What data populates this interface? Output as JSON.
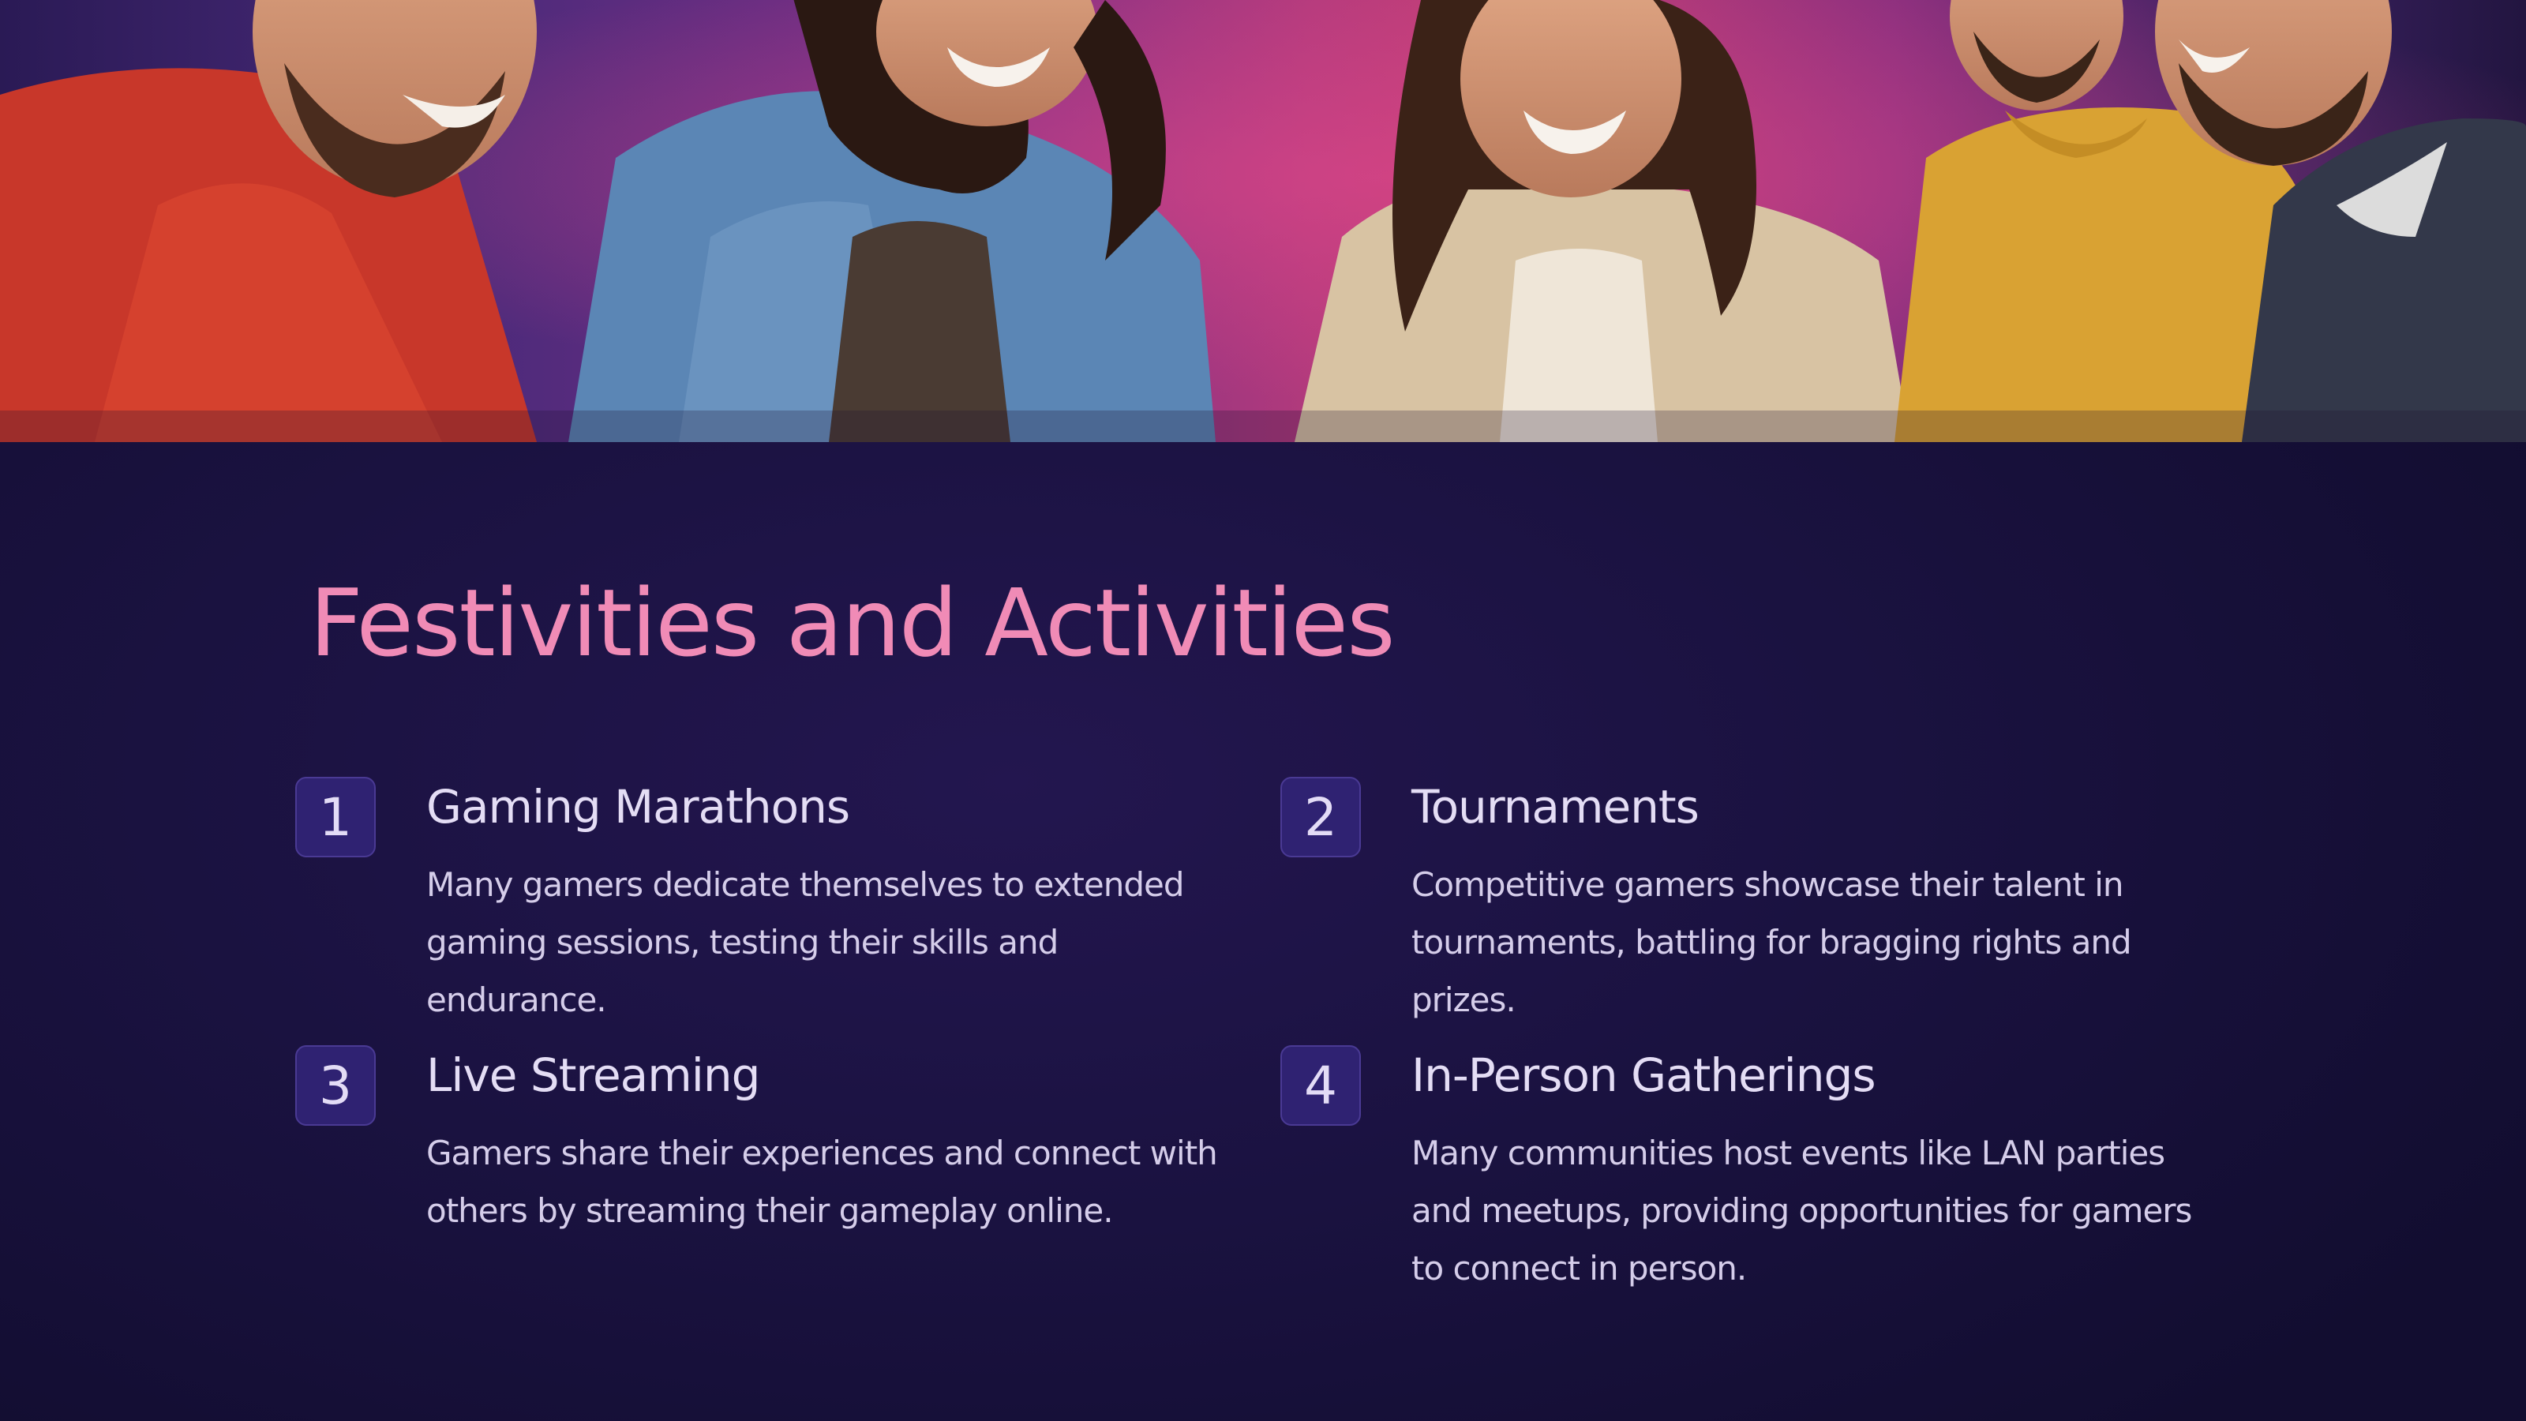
{
  "slide": {
    "title": "Festivities and Activities",
    "items": [
      {
        "number": "1",
        "heading": "Gaming Marathons",
        "text": "Many gamers dedicate themselves to extended gaming sessions, testing their skills and endurance."
      },
      {
        "number": "2",
        "heading": "Tournaments",
        "text": "Competitive gamers showcase their talent in tournaments, battling for bragging rights and prizes."
      },
      {
        "number": "3",
        "heading": "Live Streaming",
        "text": "Gamers share their experiences and connect with others by streaming their gameplay online."
      },
      {
        "number": "4",
        "heading": "In-Person Gatherings",
        "text": "Many communities host events like LAN parties and meetups, providing opportunities for gamers to connect in person."
      }
    ]
  },
  "colors": {
    "background": "#120d30",
    "title": "#f08bb6",
    "badge": "#2f2272",
    "heading": "#e4ddf5",
    "body_text": "#d5cdea"
  }
}
